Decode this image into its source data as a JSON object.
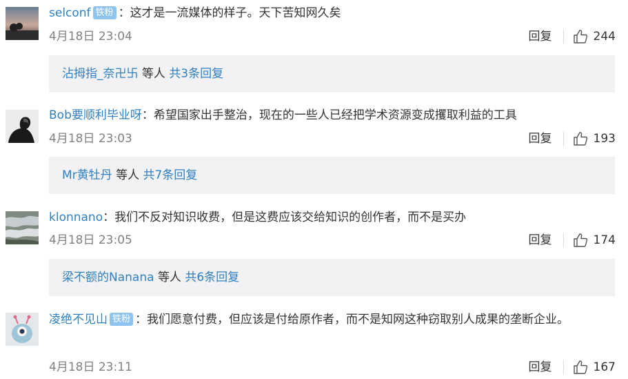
{
  "comments": [
    {
      "user": "selconf",
      "badge": "铁粉",
      "colon": "：",
      "text": "这才是一流媒体的样子。天下苦知网久矣",
      "time": "4月18日 23:04",
      "reply_label": "回复",
      "likes": "244",
      "replies": {
        "names": "沾拇指_奈卍卐",
        "mid": "等人",
        "count": "共3条回复"
      }
    },
    {
      "user": "Bob要顺利毕业呀",
      "colon": "：",
      "text": "希望国家出手整治，现在的一些人已经把学术资源变成攫取利益的工具",
      "time": "4月18日 23:03",
      "reply_label": "回复",
      "likes": "193",
      "replies": {
        "names": "Mr黄牡丹",
        "mid": "等人",
        "count": "共7条回复"
      }
    },
    {
      "user": "klonnano",
      "colon": "：",
      "text": "我们不反对知识收费，但是这费应该交给知识的创作者，而不是买办",
      "time": "4月18日 23:05",
      "reply_label": "回复",
      "likes": "174",
      "replies": {
        "names": "梁不额的Nanana",
        "mid": "等人",
        "count": "共6条回复"
      }
    },
    {
      "user": "凌绝不见山",
      "badge": "铁粉",
      "colon": "：",
      "text": "我们愿意付费，但应该是付给原作者，而不是知网这种窃取别人成果的垄断企业。",
      "time": "4月18日 23:11",
      "reply_label": "回复",
      "likes": "167"
    }
  ]
}
